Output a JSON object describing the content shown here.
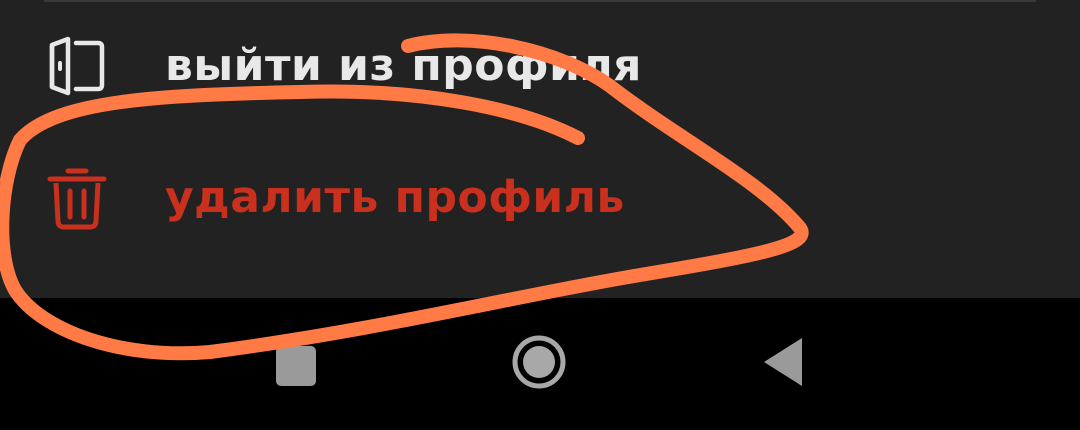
{
  "menu": {
    "logout": {
      "label": "выйти из профиля",
      "icon": "logout-door-icon",
      "color": "#e8e8e8"
    },
    "delete": {
      "label": "удалить профиль",
      "icon": "trash-icon",
      "color": "#c9301e"
    }
  },
  "navigation": {
    "recents_icon": "recents-square-icon",
    "home_icon": "home-circle-icon",
    "back_icon": "back-triangle-icon"
  },
  "annotation": {
    "color": "#ff7a45"
  }
}
